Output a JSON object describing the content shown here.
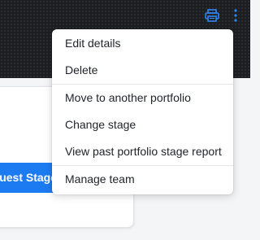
{
  "header": {
    "print_icon": "printer-icon",
    "more_icon": "kebab-vertical-icon",
    "icon_color": "#2d86f5"
  },
  "background_card": {
    "stage_button_label": "Request Stage",
    "accent": "#1d7bf2"
  },
  "menu": {
    "groups": [
      [
        {
          "label": "Edit details"
        },
        {
          "label": "Delete"
        }
      ],
      [
        {
          "label": "Move to another portfolio"
        },
        {
          "label": "Change stage"
        },
        {
          "label": "View past portfolio stage report"
        }
      ],
      [
        {
          "label": "Manage team"
        }
      ]
    ]
  }
}
